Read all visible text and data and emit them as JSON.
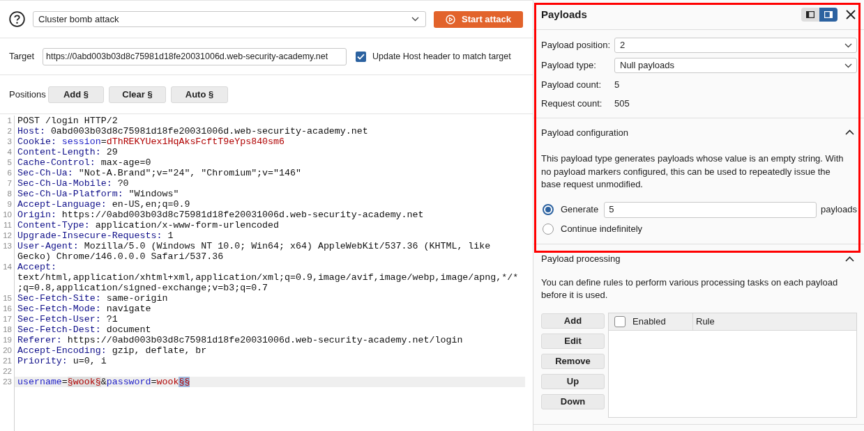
{
  "toolbar": {
    "attack_type": "Cluster bomb attack",
    "start_button": "Start attack"
  },
  "target": {
    "label": "Target",
    "value": "https://0abd003b03d8c75981d18fe20031006d.web-security-academy.net",
    "update_host": {
      "label": "Update Host header to match target",
      "checked": true
    }
  },
  "positions": {
    "label": "Positions",
    "buttons": [
      "Add §",
      "Clear §",
      "Auto §"
    ]
  },
  "editor": {
    "lines": [
      {
        "number": "1",
        "current": false,
        "tokens": [
          {
            "kind": "text",
            "text": "POST /login HTTP/2"
          }
        ]
      },
      {
        "number": "2",
        "current": false,
        "tokens": [
          {
            "kind": "header_name",
            "text": "Host:"
          },
          {
            "kind": "text",
            "text": " 0abd003b03d8c75981d18fe20031006d.web-security-academy.net"
          }
        ]
      },
      {
        "number": "3",
        "current": false,
        "tokens": [
          {
            "kind": "header_name",
            "text": "Cookie:"
          },
          {
            "kind": "param_name",
            "text": " session"
          },
          {
            "kind": "text",
            "text": "="
          },
          {
            "kind": "param_value",
            "text": "dThREKYUex1HqAksFcftT9eYps840sm6"
          }
        ]
      },
      {
        "number": "4",
        "current": false,
        "tokens": [
          {
            "kind": "header_name",
            "text": "Content-Length:"
          },
          {
            "kind": "text",
            "text": " 29"
          }
        ]
      },
      {
        "number": "5",
        "current": false,
        "tokens": [
          {
            "kind": "header_name",
            "text": "Cache-Control:"
          },
          {
            "kind": "text",
            "text": " max-age=0"
          }
        ]
      },
      {
        "number": "6",
        "current": false,
        "tokens": [
          {
            "kind": "header_name",
            "text": "Sec-Ch-Ua:"
          },
          {
            "kind": "text",
            "text": " \"Not-A.Brand\";v=\"24\", \"Chromium\";v=\"146\""
          }
        ]
      },
      {
        "number": "7",
        "current": false,
        "tokens": [
          {
            "kind": "header_name",
            "text": "Sec-Ch-Ua-Mobile:"
          },
          {
            "kind": "text",
            "text": " ?0"
          }
        ]
      },
      {
        "number": "8",
        "current": false,
        "tokens": [
          {
            "kind": "header_name",
            "text": "Sec-Ch-Ua-Platform:"
          },
          {
            "kind": "text",
            "text": " \"Windows\""
          }
        ]
      },
      {
        "number": "9",
        "current": false,
        "tokens": [
          {
            "kind": "header_name",
            "text": "Accept-Language:"
          },
          {
            "kind": "text",
            "text": " en-US,en;q=0.9"
          }
        ]
      },
      {
        "number": "10",
        "current": false,
        "tokens": [
          {
            "kind": "header_name",
            "text": "Origin:"
          },
          {
            "kind": "text",
            "text": " https://0abd003b03d8c75981d18fe20031006d.web-security-academy.net"
          }
        ]
      },
      {
        "number": "11",
        "current": false,
        "tokens": [
          {
            "kind": "header_name",
            "text": "Content-Type:"
          },
          {
            "kind": "text",
            "text": " application/x-www-form-urlencoded"
          }
        ]
      },
      {
        "number": "12",
        "current": false,
        "tokens": [
          {
            "kind": "header_name",
            "text": "Upgrade-Insecure-Requests:"
          },
          {
            "kind": "text",
            "text": " 1"
          }
        ]
      },
      {
        "number": "13",
        "current": false,
        "tokens": [
          {
            "kind": "header_name",
            "text": "User-Agent:"
          },
          {
            "kind": "text",
            "text": " Mozilla/5.0 (Windows NT 10.0; Win64; x64) AppleWebKit/537.36 (KHTML, like Gecko) Chrome/146.0.0.0 Safari/537.36"
          }
        ]
      },
      {
        "number": "14",
        "current": false,
        "tokens": [
          {
            "kind": "header_name",
            "text": "Accept:"
          },
          {
            "kind": "text",
            "text": " text/html,application/xhtml+xml,application/xml;q=0.9,image/avif,image/webp,image/apng,*/*;q=0.8,application/signed-exchange;v=b3;q=0.7"
          }
        ]
      },
      {
        "number": "15",
        "current": false,
        "tokens": [
          {
            "kind": "header_name",
            "text": "Sec-Fetch-Site:"
          },
          {
            "kind": "text",
            "text": " same-origin"
          }
        ]
      },
      {
        "number": "16",
        "current": false,
        "tokens": [
          {
            "kind": "header_name",
            "text": "Sec-Fetch-Mode:"
          },
          {
            "kind": "text",
            "text": " navigate"
          }
        ]
      },
      {
        "number": "17",
        "current": false,
        "tokens": [
          {
            "kind": "header_name",
            "text": "Sec-Fetch-User:"
          },
          {
            "kind": "text",
            "text": " ?1"
          }
        ]
      },
      {
        "number": "18",
        "current": false,
        "tokens": [
          {
            "kind": "header_name",
            "text": "Sec-Fetch-Dest:"
          },
          {
            "kind": "text",
            "text": " document"
          }
        ]
      },
      {
        "number": "19",
        "current": false,
        "tokens": [
          {
            "kind": "header_name",
            "text": "Referer:"
          },
          {
            "kind": "text",
            "text": " https://0abd003b03d8c75981d18fe20031006d.web-security-academy.net/login"
          }
        ]
      },
      {
        "number": "20",
        "current": false,
        "tokens": [
          {
            "kind": "header_name",
            "text": "Accept-Encoding:"
          },
          {
            "kind": "text",
            "text": " gzip, deflate, br"
          }
        ]
      },
      {
        "number": "21",
        "current": false,
        "tokens": [
          {
            "kind": "header_name",
            "text": "Priority:"
          },
          {
            "kind": "text",
            "text": " u=0, i"
          }
        ]
      },
      {
        "number": "22",
        "current": false
      },
      {
        "number": "23",
        "current": true,
        "tokens": [
          {
            "kind": "param_name",
            "text": "username"
          },
          {
            "kind": "text",
            "text": "="
          },
          {
            "kind": "position",
            "text": "§wook§",
            "selected": false
          },
          {
            "kind": "text",
            "text": "&"
          },
          {
            "kind": "param_name",
            "text": "password"
          },
          {
            "kind": "text",
            "text": "="
          },
          {
            "kind": "param_value",
            "text": "wook"
          },
          {
            "kind": "position",
            "text": "§§",
            "selected": true
          }
        ]
      }
    ]
  },
  "payloads_panel": {
    "title": "Payloads",
    "highlighted": true,
    "layout_toggle": [
      {
        "kind": "dock_left",
        "selected": false
      },
      {
        "kind": "dock_right",
        "selected": true
      }
    ],
    "settings": [
      {
        "kind": "select",
        "label": "Payload position:",
        "value": "2"
      },
      {
        "kind": "select",
        "label": "Payload type:",
        "value": "Null payloads"
      },
      {
        "kind": "text",
        "label": "Payload count:",
        "value": "5"
      },
      {
        "kind": "text",
        "label": "Request count:",
        "value": "505"
      }
    ],
    "configuration": {
      "title": "Payload configuration",
      "expanded": true,
      "description": "This payload type generates payloads whose value is an empty string. With no payload markers configured, this can be used to repeatedly issue the base request unmodified.",
      "options": [
        {
          "label": "Generate",
          "selected": true,
          "value": "5",
          "suffix": "payloads"
        },
        {
          "label": "Continue indefinitely",
          "selected": false
        }
      ]
    },
    "processing": {
      "title": "Payload processing",
      "expanded": true,
      "description": "You can define rules to perform various processing tasks on each payload before it is used.",
      "buttons": [
        "Add",
        "Edit",
        "Remove",
        "Up",
        "Down"
      ],
      "table": {
        "select_all": {
          "checked": false
        },
        "columns": [
          "Enabled",
          "Rule"
        ]
      }
    }
  }
}
